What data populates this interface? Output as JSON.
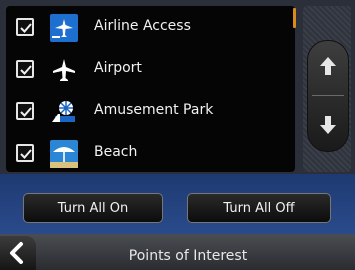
{
  "poi_list": {
    "items": [
      {
        "label": "Airline Access",
        "checked": true,
        "icon": "airline-access-icon"
      },
      {
        "label": "Airport",
        "checked": true,
        "icon": "airport-icon"
      },
      {
        "label": "Amusement Park",
        "checked": true,
        "icon": "amusement-park-icon"
      },
      {
        "label": "Beach",
        "checked": true,
        "icon": "beach-icon"
      }
    ]
  },
  "actions": {
    "turn_all_on": "Turn All On",
    "turn_all_off": "Turn All Off"
  },
  "header": {
    "title": "Points of Interest"
  },
  "colors": {
    "list_background": "#050505",
    "button_bar": "#23407c",
    "scroll_indicator": "#d98a1c",
    "text": "#f2f2f2"
  }
}
